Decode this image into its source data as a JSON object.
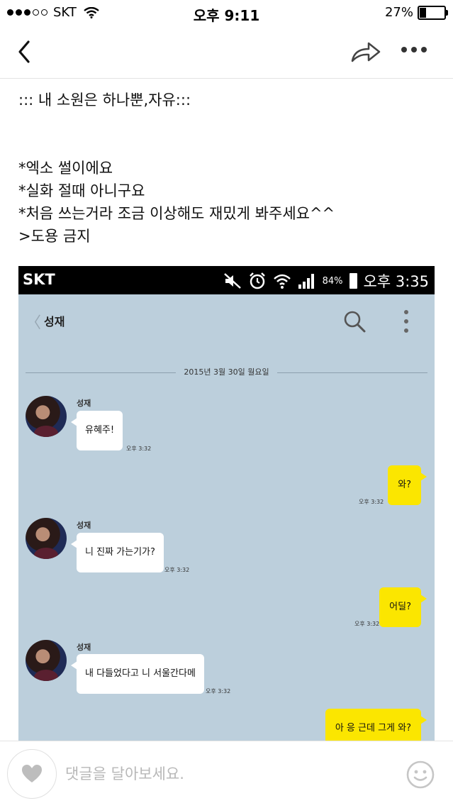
{
  "ios_status": {
    "carrier": "SKT",
    "time": "오후 9:11",
    "battery": "27%",
    "battery_level": 0.27
  },
  "post": {
    "title": "::: 내 소원은 하나뿐,자유:::",
    "lines": [
      "*엑소 썰이에요",
      "*실화 절때 아니구요",
      "*처음 쓰는거라 조금 이상해도 재밌게 봐주세요^^",
      ">도용 금지"
    ]
  },
  "embedded_chat": {
    "status": {
      "carrier": "SKT",
      "battery": "84%",
      "time": "오후 3:35"
    },
    "header": {
      "contact": "성재"
    },
    "date_divider": "2015년 3월 30일 월요일",
    "messages": [
      {
        "sender": "성재",
        "text": "유혜주!",
        "time": "오후 3:32"
      },
      {
        "text": "와?",
        "time": "오후 3:32"
      },
      {
        "sender": "성재",
        "text": "니 진짜 가는기가?",
        "time": "오후 3:32"
      },
      {
        "text": "어딜?",
        "time": "오후 3:32"
      },
      {
        "sender": "성재",
        "text": "내 다들었다고 니 서울간다메",
        "time": "오후 3:32"
      },
      {
        "text": "아 응 근데 그게 와?"
      }
    ]
  },
  "comment_bar": {
    "placeholder": "댓글을 달아보세요."
  },
  "icons": [
    "back-chevron-icon",
    "share-icon",
    "more-icon",
    "heart-icon",
    "smiley-icon",
    "search-icon"
  ]
}
